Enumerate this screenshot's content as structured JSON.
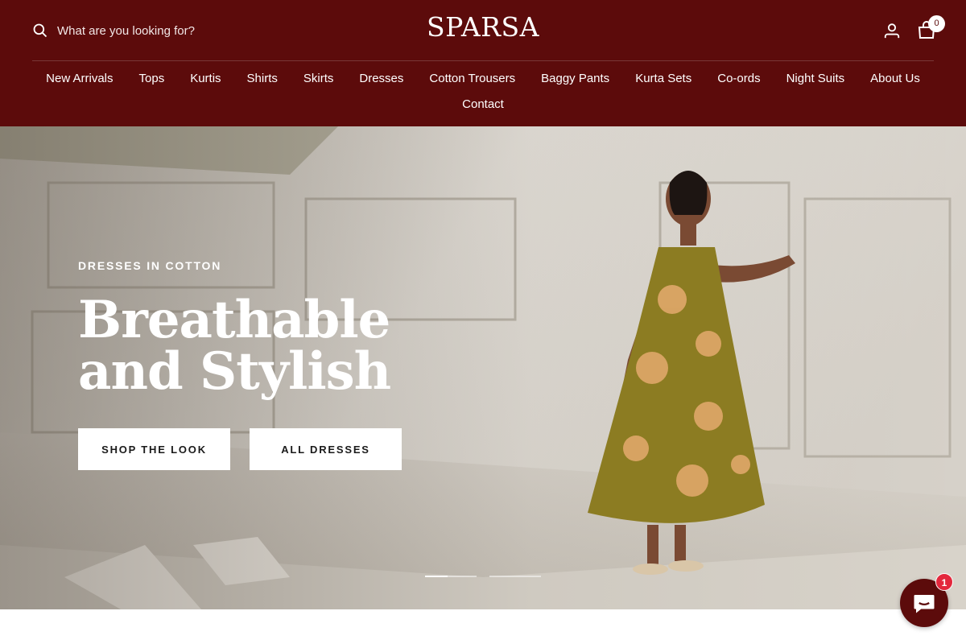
{
  "header": {
    "search": {
      "placeholder": "What are you looking for?"
    },
    "logo": "SPARSA",
    "cart_count": "0",
    "background_color": "#5c0b0b"
  },
  "nav": {
    "items": [
      "New Arrivals",
      "Tops",
      "Kurtis",
      "Shirts",
      "Skirts",
      "Dresses",
      "Cotton Trousers",
      "Baggy Pants",
      "Kurta Sets",
      "Co-ords",
      "Night Suits",
      "About Us",
      "Contact"
    ]
  },
  "hero": {
    "eyebrow": "DRESSES IN COTTON",
    "headline": "Breathable and Stylish",
    "primary_cta": "SHOP THE LOOK",
    "secondary_cta": "ALL DRESSES",
    "slide_count": 2,
    "active_slide": 1
  },
  "chat": {
    "badge": "1",
    "icon": "chat-bubble-icon"
  }
}
